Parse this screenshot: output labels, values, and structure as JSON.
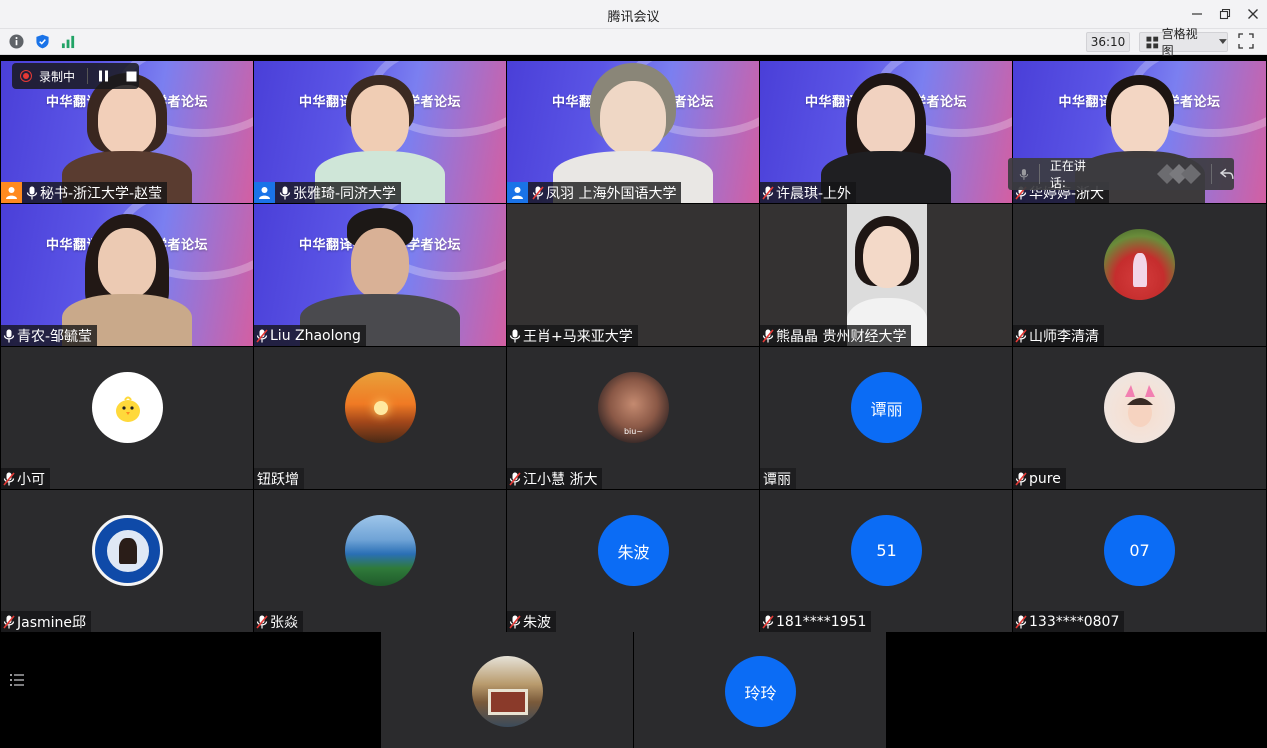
{
  "window": {
    "title": "腾讯会议"
  },
  "toolbar": {
    "timer": "36:10",
    "view_label": "宫格视图",
    "icons": [
      "info-icon",
      "shield-icon",
      "signal-icon",
      "grid-icon",
      "fullscreen-icon"
    ]
  },
  "recording": {
    "label": "录制中"
  },
  "speaking": {
    "label": "正在讲话:"
  },
  "banner": {
    "title": "中华翻译研究青年学者论坛"
  },
  "participants": [
    {
      "name": "秘书-浙江大学-赵莹",
      "badge": "host",
      "muted": false
    },
    {
      "name": "张雅琦-同济大学",
      "badge": "cohost",
      "muted": false
    },
    {
      "name": "凤羽 上海外国语大学",
      "badge": "cohost",
      "muted": true
    },
    {
      "name": "许晨琪-上外",
      "badge": "",
      "muted": true
    },
    {
      "name": "华婷婷-浙大",
      "badge": "",
      "muted": true
    },
    {
      "name": "青农-邹毓莹",
      "badge": "",
      "muted": false
    },
    {
      "name": "Liu Zhaolong",
      "badge": "",
      "muted": true
    },
    {
      "name": "王肖+马来亚大学",
      "badge": "",
      "muted": false
    },
    {
      "name": "熊晶晶  贵州财经大学",
      "badge": "",
      "muted": true
    },
    {
      "name": "山师李清清",
      "badge": "",
      "muted": true
    },
    {
      "name": "小可",
      "badge": "",
      "muted": true
    },
    {
      "name": "钮跃增",
      "badge": "",
      "muted": false
    },
    {
      "name": "江小慧 浙大",
      "badge": "",
      "muted": true
    },
    {
      "name": "谭丽",
      "badge": "",
      "muted": false,
      "avatar_text": "谭丽"
    },
    {
      "name": "pure",
      "badge": "",
      "muted": true
    },
    {
      "name": "Jasmine邱",
      "badge": "",
      "muted": true
    },
    {
      "name": "张焱",
      "badge": "",
      "muted": true
    },
    {
      "name": "朱波",
      "badge": "",
      "muted": true,
      "avatar_text": "朱波"
    },
    {
      "name": "181****1951",
      "badge": "",
      "muted": true,
      "avatar_text": "51"
    },
    {
      "name": "133****0807",
      "badge": "",
      "muted": true,
      "avatar_text": "07"
    }
  ],
  "bottom_row": [
    {
      "avatar_text": ""
    },
    {
      "avatar_text": "玲玲"
    }
  ],
  "colors": {
    "accent_blue": "#0b6cf5",
    "host_orange": "#ff8a1f",
    "muted_red": "#e53935",
    "tile_bg": "#2b2b2d"
  }
}
